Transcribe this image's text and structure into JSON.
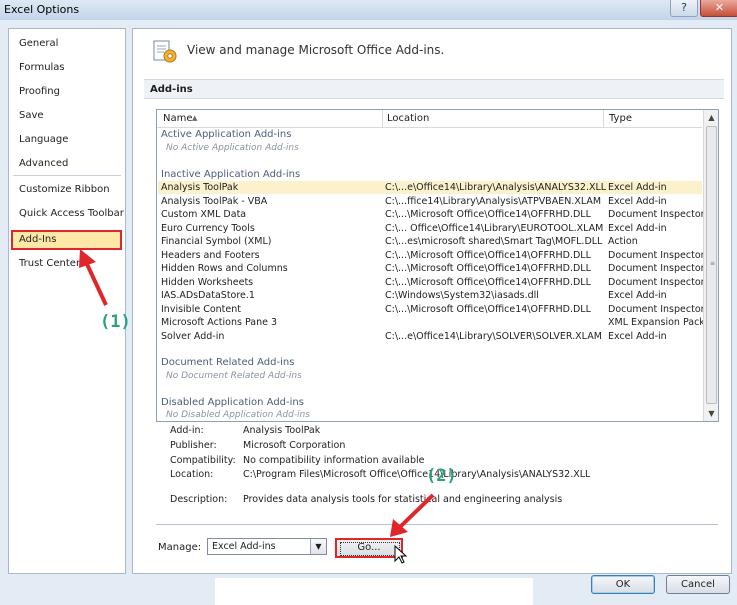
{
  "window": {
    "title": "Excel Options",
    "help_glyph": "?",
    "close_glyph": "✕"
  },
  "sidebar": {
    "items": [
      {
        "label": "General"
      },
      {
        "label": "Formulas"
      },
      {
        "label": "Proofing"
      },
      {
        "label": "Save"
      },
      {
        "label": "Language"
      },
      {
        "label": "Advanced"
      },
      {
        "label": "Customize Ribbon"
      },
      {
        "label": "Quick Access Toolbar"
      },
      {
        "label": "Add-Ins",
        "selected": true
      },
      {
        "label": "Trust Center"
      }
    ]
  },
  "header": {
    "text": "View and manage Microsoft Office Add-ins.",
    "icon": "add-ins-gear-icon"
  },
  "section": {
    "title": "Add-ins"
  },
  "table": {
    "columns": [
      "Name",
      "Location",
      "Type"
    ],
    "sort_glyph": "▲",
    "groups": {
      "active": {
        "title": "Active Application Add-ins",
        "empty": "No Active Application Add-ins"
      },
      "inactive": {
        "title": "Inactive Application Add-ins",
        "rows": [
          {
            "name": "Analysis ToolPak",
            "location": "C:\\...e\\Office14\\Library\\Analysis\\ANALYS32.XLL",
            "type": "Excel Add-in",
            "selected": true
          },
          {
            "name": "Analysis ToolPak - VBA",
            "location": "C:\\...ffice14\\Library\\Analysis\\ATPVBAEN.XLAM",
            "type": "Excel Add-in"
          },
          {
            "name": "Custom XML Data",
            "location": "C:\\...\\Microsoft Office\\Office14\\OFFRHD.DLL",
            "type": "Document Inspector"
          },
          {
            "name": "Euro Currency Tools",
            "location": "C:\\... Office\\Office14\\Library\\EUROTOOL.XLAM",
            "type": "Excel Add-in"
          },
          {
            "name": "Financial Symbol (XML)",
            "location": "C:\\...es\\microsoft shared\\Smart Tag\\MOFL.DLL",
            "type": "Action"
          },
          {
            "name": "Headers and Footers",
            "location": "C:\\...\\Microsoft Office\\Office14\\OFFRHD.DLL",
            "type": "Document Inspector"
          },
          {
            "name": "Hidden Rows and Columns",
            "location": "C:\\...\\Microsoft Office\\Office14\\OFFRHD.DLL",
            "type": "Document Inspector"
          },
          {
            "name": "Hidden Worksheets",
            "location": "C:\\...\\Microsoft Office\\Office14\\OFFRHD.DLL",
            "type": "Document Inspector"
          },
          {
            "name": "IAS.ADsDataStore.1",
            "location": "C:\\Windows\\System32\\iasads.dll",
            "type": "Excel Add-in"
          },
          {
            "name": "Invisible Content",
            "location": "C:\\...\\Microsoft Office\\Office14\\OFFRHD.DLL",
            "type": "Document Inspector"
          },
          {
            "name": "Microsoft Actions Pane 3",
            "location": "",
            "type": "XML Expansion Pack"
          },
          {
            "name": "Solver Add-in",
            "location": "C:\\...e\\Office14\\Library\\SOLVER\\SOLVER.XLAM",
            "type": "Excel Add-in"
          }
        ]
      },
      "document": {
        "title": "Document Related Add-ins",
        "empty": "No Document Related Add-ins"
      },
      "disabled": {
        "title": "Disabled Application Add-ins",
        "empty": "No Disabled Application Add-ins"
      }
    }
  },
  "details": {
    "addin_label": "Add-in:",
    "addin_value": "Analysis ToolPak",
    "publisher_label": "Publisher:",
    "publisher_value": "Microsoft Corporation",
    "compat_label": "Compatibility:",
    "compat_value": "No compatibility information available",
    "location_label": "Location:",
    "location_value": "C:\\Program Files\\Microsoft Office\\Office14\\Library\\Analysis\\ANALYS32.XLL",
    "description_label": "Description:",
    "description_value": "Provides data analysis tools for statistical and engineering analysis"
  },
  "manage": {
    "label": "Manage:",
    "selected": "Excel Add-ins",
    "go_label": "Go..."
  },
  "footer": {
    "ok_label": "OK",
    "cancel_label": "Cancel"
  },
  "annotations": {
    "step1": "(1)",
    "step2": "(2)"
  },
  "colors": {
    "highlight_border": "#e0262a",
    "annotation_text": "#2aa37a",
    "selection_fill": "#fde8a8"
  }
}
